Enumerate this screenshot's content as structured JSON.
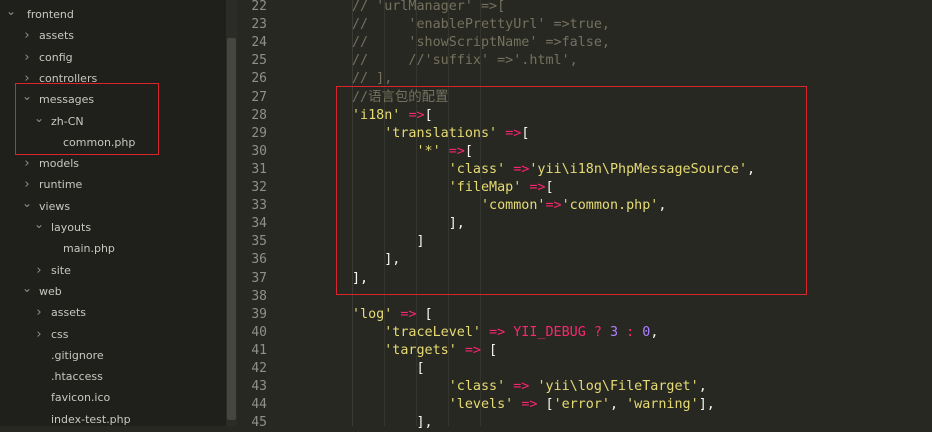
{
  "sidebar": {
    "items": [
      {
        "label": "frontend",
        "depth": 0,
        "type": "folder-open"
      },
      {
        "label": "assets",
        "depth": 1,
        "type": "folder"
      },
      {
        "label": "config",
        "depth": 1,
        "type": "folder"
      },
      {
        "label": "controllers",
        "depth": 1,
        "type": "folder"
      },
      {
        "label": "messages",
        "depth": 1,
        "type": "folder-open"
      },
      {
        "label": "zh-CN",
        "depth": 2,
        "type": "folder-open"
      },
      {
        "label": "common.php",
        "depth": 3,
        "type": "file"
      },
      {
        "label": "models",
        "depth": 1,
        "type": "folder"
      },
      {
        "label": "runtime",
        "depth": 1,
        "type": "folder"
      },
      {
        "label": "views",
        "depth": 1,
        "type": "folder-open"
      },
      {
        "label": "layouts",
        "depth": 2,
        "type": "folder-open"
      },
      {
        "label": "main.php",
        "depth": 3,
        "type": "file"
      },
      {
        "label": "site",
        "depth": 2,
        "type": "folder"
      },
      {
        "label": "web",
        "depth": 1,
        "type": "folder-open"
      },
      {
        "label": "assets",
        "depth": 2,
        "type": "folder"
      },
      {
        "label": "css",
        "depth": 2,
        "type": "folder"
      },
      {
        "label": ".gitignore",
        "depth": 2,
        "type": "file"
      },
      {
        "label": ".htaccess",
        "depth": 2,
        "type": "file"
      },
      {
        "label": "favicon.ico",
        "depth": 2,
        "type": "file"
      },
      {
        "label": "index-test.php",
        "depth": 2,
        "type": "file"
      }
    ]
  },
  "editor": {
    "lines": [
      {
        "n": "22",
        "tokens": [
          [
            "c",
            "// 'urlManager' =>["
          ]
        ]
      },
      {
        "n": "23",
        "tokens": [
          [
            "c",
            "//     'enablePrettyUrl' =>true,"
          ]
        ]
      },
      {
        "n": "24",
        "tokens": [
          [
            "c",
            "//     'showScriptName' =>false,"
          ]
        ]
      },
      {
        "n": "25",
        "tokens": [
          [
            "c",
            "//     //'suffix' =>'.html',"
          ]
        ]
      },
      {
        "n": "26",
        "tokens": [
          [
            "c",
            "// ],"
          ]
        ]
      },
      {
        "n": "27",
        "tokens": [
          [
            "c",
            "//语言包的配置"
          ]
        ]
      },
      {
        "n": "28",
        "tokens": [
          [
            "s",
            "'i18n'"
          ],
          [
            "p",
            " "
          ],
          [
            "o",
            "=>"
          ],
          [
            "p",
            "["
          ]
        ]
      },
      {
        "n": "29",
        "tokens": [
          [
            "p",
            "    "
          ],
          [
            "s",
            "'translations'"
          ],
          [
            "p",
            " "
          ],
          [
            "o",
            "=>"
          ],
          [
            "p",
            "["
          ]
        ]
      },
      {
        "n": "30",
        "tokens": [
          [
            "p",
            "        "
          ],
          [
            "s",
            "'*'"
          ],
          [
            "p",
            " "
          ],
          [
            "o",
            "=>"
          ],
          [
            "p",
            "["
          ]
        ]
      },
      {
        "n": "31",
        "tokens": [
          [
            "p",
            "            "
          ],
          [
            "s",
            "'class'"
          ],
          [
            "p",
            " "
          ],
          [
            "o",
            "=>"
          ],
          [
            "s",
            "'yii\\i18n\\PhpMessageSource'"
          ],
          [
            "p",
            ","
          ]
        ]
      },
      {
        "n": "32",
        "tokens": [
          [
            "p",
            "            "
          ],
          [
            "s",
            "'fileMap'"
          ],
          [
            "p",
            " "
          ],
          [
            "o",
            "=>"
          ],
          [
            "p",
            "["
          ]
        ]
      },
      {
        "n": "33",
        "tokens": [
          [
            "p",
            "                "
          ],
          [
            "s",
            "'common'"
          ],
          [
            "o",
            "=>"
          ],
          [
            "s",
            "'common.php'"
          ],
          [
            "p",
            ","
          ]
        ]
      },
      {
        "n": "34",
        "tokens": [
          [
            "p",
            "            ],"
          ]
        ]
      },
      {
        "n": "35",
        "tokens": [
          [
            "p",
            "        ]"
          ]
        ]
      },
      {
        "n": "36",
        "tokens": [
          [
            "p",
            "    ],"
          ]
        ]
      },
      {
        "n": "37",
        "tokens": [
          [
            "p",
            "],"
          ]
        ]
      },
      {
        "n": "38",
        "tokens": []
      },
      {
        "n": "39",
        "tokens": [
          [
            "s",
            "'log'"
          ],
          [
            "p",
            " "
          ],
          [
            "o",
            "=>"
          ],
          [
            "p",
            " ["
          ]
        ]
      },
      {
        "n": "40",
        "tokens": [
          [
            "p",
            "    "
          ],
          [
            "s",
            "'traceLevel'"
          ],
          [
            "p",
            " "
          ],
          [
            "o",
            "=>"
          ],
          [
            "p",
            " "
          ],
          [
            "k",
            "YII_DEBUG"
          ],
          [
            "p",
            " "
          ],
          [
            "o",
            "?"
          ],
          [
            "p",
            " "
          ],
          [
            "n",
            "3"
          ],
          [
            "p",
            " "
          ],
          [
            "o",
            ":"
          ],
          [
            "p",
            " "
          ],
          [
            "n",
            "0"
          ],
          [
            "p",
            ","
          ]
        ]
      },
      {
        "n": "41",
        "tokens": [
          [
            "p",
            "    "
          ],
          [
            "s",
            "'targets'"
          ],
          [
            "p",
            " "
          ],
          [
            "o",
            "=>"
          ],
          [
            "p",
            " ["
          ]
        ]
      },
      {
        "n": "42",
        "tokens": [
          [
            "p",
            "        ["
          ]
        ]
      },
      {
        "n": "43",
        "tokens": [
          [
            "p",
            "            "
          ],
          [
            "s",
            "'class'"
          ],
          [
            "p",
            " "
          ],
          [
            "o",
            "=>"
          ],
          [
            "p",
            " "
          ],
          [
            "s",
            "'yii\\log\\FileTarget'"
          ],
          [
            "p",
            ","
          ]
        ]
      },
      {
        "n": "44",
        "tokens": [
          [
            "p",
            "            "
          ],
          [
            "s",
            "'levels'"
          ],
          [
            "p",
            " "
          ],
          [
            "o",
            "=>"
          ],
          [
            "p",
            " ["
          ],
          [
            "s",
            "'error'"
          ],
          [
            "p",
            ", "
          ],
          [
            "s",
            "'warning'"
          ],
          [
            "p",
            "],"
          ]
        ]
      },
      {
        "n": "45",
        "tokens": [
          [
            "p",
            "        ],"
          ]
        ]
      }
    ]
  },
  "icons": {
    "expanded": "chevron-down-icon",
    "collapsed": "chevron-right-icon"
  },
  "colors": {
    "highlight": "#d9252c",
    "comment": "#75715e",
    "string": "#e6db74",
    "operator": "#f92672",
    "number": "#ae81ff"
  }
}
